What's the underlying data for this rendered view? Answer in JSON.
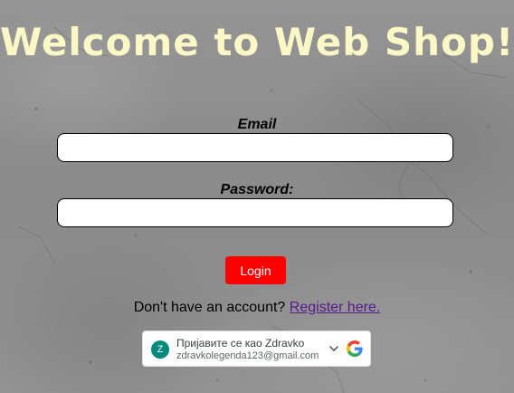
{
  "page": {
    "title": "Welcome to Web Shop!"
  },
  "login_form": {
    "email_label": "Email",
    "email_value": "",
    "password_label": "Password:",
    "password_value": "",
    "login_button": "Login"
  },
  "register": {
    "prompt": "Don't have an account?",
    "link_text": "Register here."
  },
  "google_signin": {
    "avatar_letter": "Z",
    "prompt": "Пријавите се као Zdravko",
    "account_email": "zdravkolegenda123@gmail.com",
    "chevron_icon": "chevron-down-icon",
    "logo_icon": "google-logo-icon"
  },
  "colors": {
    "title": "#fbf7c6",
    "login_button": "#ff0000",
    "link": "#551a8b",
    "avatar": "#00897b"
  }
}
